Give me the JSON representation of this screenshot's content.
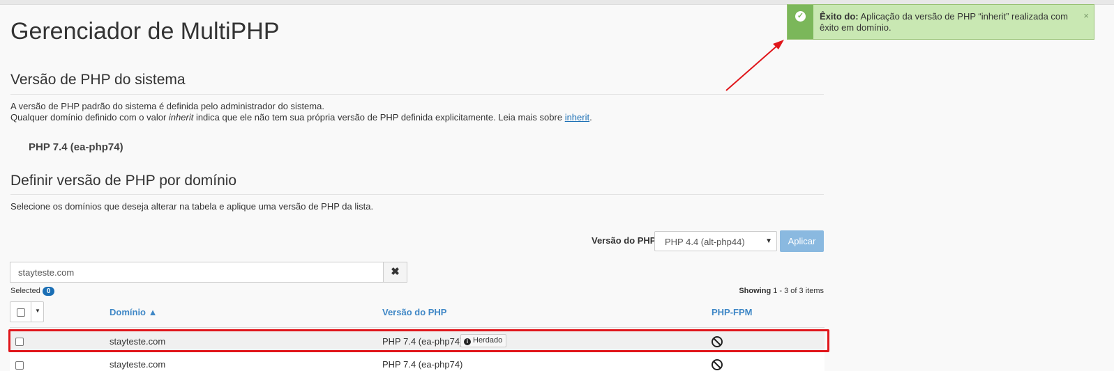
{
  "page": {
    "title": "Gerenciador de MultiPHP"
  },
  "system_php": {
    "heading": "Versão de PHP do sistema",
    "desc_line1": "A versão de PHP padrão do sistema é definida pelo administrador do sistema.",
    "desc_line2_a": "Qualquer domínio definido com o valor ",
    "desc_line2_em": "inherit",
    "desc_line2_b": " indica que ele não tem sua própria versão de PHP definida explicitamente. Leia mais sobre ",
    "desc_link": "inherit",
    "desc_line2_end": ".",
    "version": "PHP 7.4 (ea-php74)"
  },
  "domain_php": {
    "heading": "Definir versão de PHP por domínio",
    "desc": "Selecione os domínios que deseja alterar na tabela e aplique uma versão de PHP da lista.",
    "version_label": "Versão do PHP",
    "version_select": "PHP 4.4 (alt-php44)",
    "apply_label": "Aplicar",
    "search_value": "stayteste.com",
    "clear_icon": "close-icon",
    "selected_label": "Selected",
    "selected_count": "0",
    "showing_prefix": "Showing",
    "showing_range": "1 - 3 of 3 items"
  },
  "table": {
    "headers": {
      "domain": "Domínio ▲",
      "php": "Versão do PHP",
      "fpm": "PHP-FPM"
    },
    "rows": [
      {
        "domain": "stayteste.com",
        "php": "PHP 7.4 (ea-php74)",
        "badge": "Herdado",
        "fpm_icon": "ban-icon"
      },
      {
        "domain": "stayteste.com",
        "php": "PHP 7.4 (ea-php74)",
        "fpm_icon": "ban-icon"
      }
    ]
  },
  "toast": {
    "title": "Êxito do:",
    "message": "Aplicação da versão de PHP “inherit” realizada com êxito em domínio.",
    "close": "×",
    "icon": "check-circle-icon"
  },
  "colors": {
    "accent": "#1b6fb5",
    "success_side": "#7bb75a",
    "success_bg": "#c9e8b3",
    "highlight": "#e0161b",
    "apply_button": "#8ab9e0"
  }
}
